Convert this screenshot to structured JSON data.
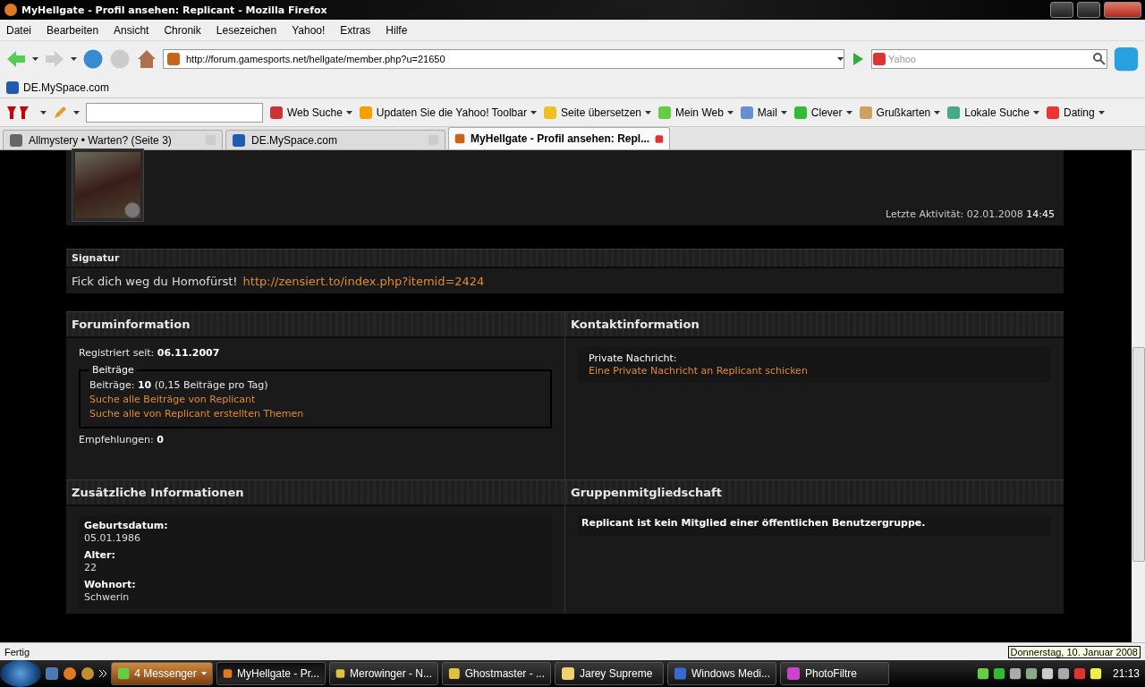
{
  "window": {
    "title": "MyHellgate - Profil ansehen: Replicant - Mozilla Firefox"
  },
  "menu": [
    "Datei",
    "Bearbeiten",
    "Ansicht",
    "Chronik",
    "Lesezeichen",
    "Yahoo!",
    "Extras",
    "Hilfe"
  ],
  "address": {
    "value": "http://forum.gamesports.net/hellgate/member.php?u=21650"
  },
  "search": {
    "placeholder": "Yahoo"
  },
  "bookmarks": [
    "DE.MySpace.com"
  ],
  "yahoo_toolbar": [
    "Web Suche",
    "Updaten Sie die Yahoo! Toolbar",
    "Seite übersetzen",
    "Mein Web",
    "Mail",
    "Clever",
    "Grußkarten",
    "Lokale Suche",
    "Dating"
  ],
  "tabs": [
    {
      "label": "Allmystery • Warten? (Seite 3)",
      "selected": false
    },
    {
      "label": "DE.MySpace.com",
      "selected": false
    },
    {
      "label": "MyHellgate - Profil ansehen: Repl...",
      "selected": true
    }
  ],
  "profile": {
    "last_activity": "Letzte Aktivität: 02.01.2008 **14:45**"
  },
  "signature": {
    "heading": "Signatur",
    "text": "Fick dich weg du Homofürst!",
    "link": "http://zensiert.to/index.php?itemid=2424"
  },
  "forum_info": {
    "heading": "Foruminformation",
    "registered": "Registriert seit: **06.11.2007**",
    "posts_legend": "Beiträge",
    "posts": "Beiträge: **10** (0,15 Beiträge pro Tag)",
    "links": [
      "Suche alle Beiträge von Replicant",
      "Suche alle von Replicant erstellten Themen"
    ],
    "recommendations": "Empfehlungen: **0**"
  },
  "contact": {
    "heading": "Kontaktinformation",
    "label": "Private Nachricht:",
    "link": "Eine Private Nachricht an Replicant schicken"
  },
  "extra": {
    "heading": "Zusätzliche Informationen",
    "fields": [
      {
        "label": "Geburtsdatum:",
        "value": "05.01.1986"
      },
      {
        "label": "Alter:",
        "value": "22"
      },
      {
        "label": "Wohnort:",
        "value": "Schwerin"
      }
    ]
  },
  "groups": {
    "heading": "Gruppenmitgliedschaft",
    "text": "Replicant ist kein Mitglied einer öffentlichen Benutzergruppe."
  },
  "status_bar": {
    "text": "Fertig",
    "tooltip": "Donnerstag, 10. Januar 2008"
  },
  "taskbar": {
    "items": [
      {
        "label": "4 Messenger",
        "selected": false,
        "kind": "group"
      },
      {
        "label": "MyHellgate - Pr...",
        "selected": true,
        "kind": "window"
      },
      {
        "label": "Merowinger - N...",
        "selected": false,
        "kind": "window"
      },
      {
        "label": "Ghostmaster - ...",
        "selected": false,
        "kind": "window"
      },
      {
        "label": "Jarey Supreme",
        "selected": false,
        "kind": "window"
      },
      {
        "label": "Windows Medi...",
        "selected": false,
        "kind": "window"
      },
      {
        "label": "PhotoFiltre",
        "selected": false,
        "kind": "window"
      }
    ],
    "clock": "21:13"
  }
}
